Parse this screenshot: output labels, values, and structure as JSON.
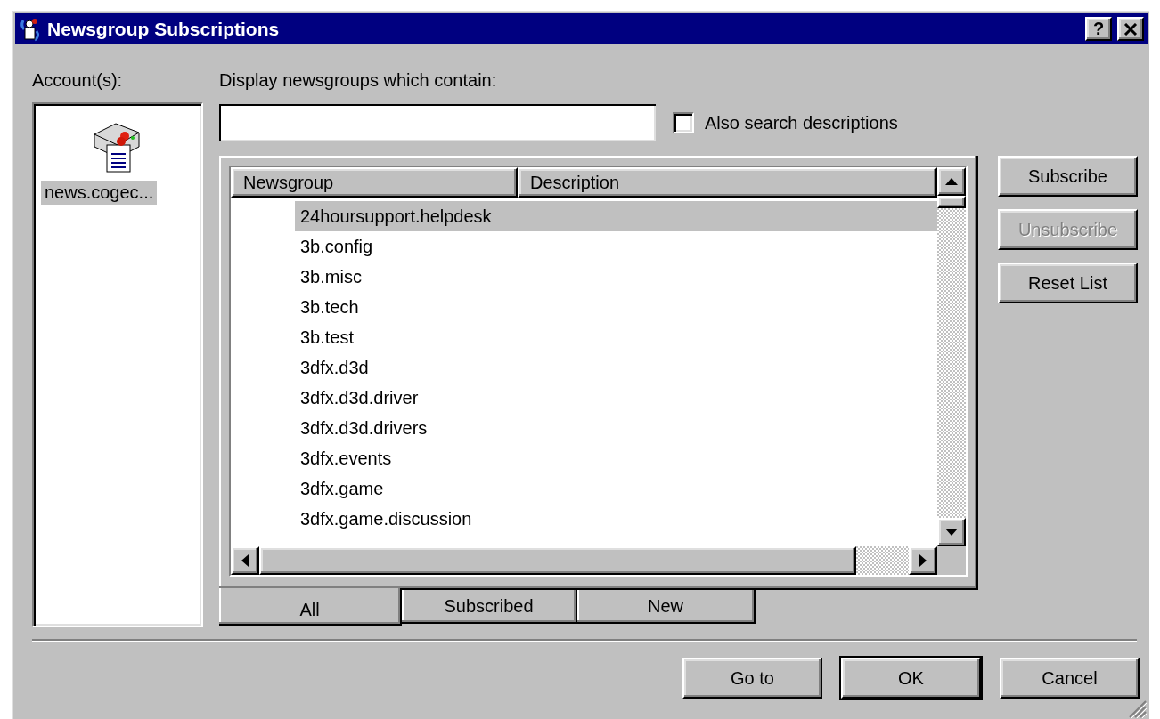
{
  "window": {
    "title": "Newsgroup Subscriptions",
    "help_button": "?"
  },
  "accounts": {
    "label": "Account(s):",
    "items": [
      {
        "name": "news.cogec...",
        "selected": true
      }
    ]
  },
  "filter": {
    "label": "Display newsgroups which contain:"
  },
  "also_search": {
    "label": "Also search descriptions",
    "checked": false
  },
  "list": {
    "columns": [
      "Newsgroup",
      "Description"
    ],
    "rows": [
      {
        "newsgroup": "24hoursupport.helpdesk",
        "selected": true
      },
      {
        "newsgroup": "3b.config",
        "selected": false
      },
      {
        "newsgroup": "3b.misc",
        "selected": false
      },
      {
        "newsgroup": "3b.tech",
        "selected": false
      },
      {
        "newsgroup": "3b.test",
        "selected": false
      },
      {
        "newsgroup": "3dfx.d3d",
        "selected": false
      },
      {
        "newsgroup": "3dfx.d3d.driver",
        "selected": false
      },
      {
        "newsgroup": "3dfx.d3d.drivers",
        "selected": false
      },
      {
        "newsgroup": "3dfx.events",
        "selected": false
      },
      {
        "newsgroup": "3dfx.game",
        "selected": false
      },
      {
        "newsgroup": "3dfx.game.discussion",
        "selected": false
      }
    ]
  },
  "tabs": [
    {
      "label": "All",
      "selected": true
    },
    {
      "label": "Subscribed",
      "selected": false
    },
    {
      "label": "New",
      "selected": false
    }
  ],
  "side_buttons": [
    {
      "label": "Subscribe",
      "disabled": false
    },
    {
      "label": "Unsubscribe",
      "disabled": true
    },
    {
      "label": "Reset List",
      "disabled": false
    }
  ],
  "footer_buttons": [
    {
      "label": "Go to",
      "default": false
    },
    {
      "label": "OK",
      "default": true
    },
    {
      "label": "Cancel",
      "default": false
    }
  ]
}
